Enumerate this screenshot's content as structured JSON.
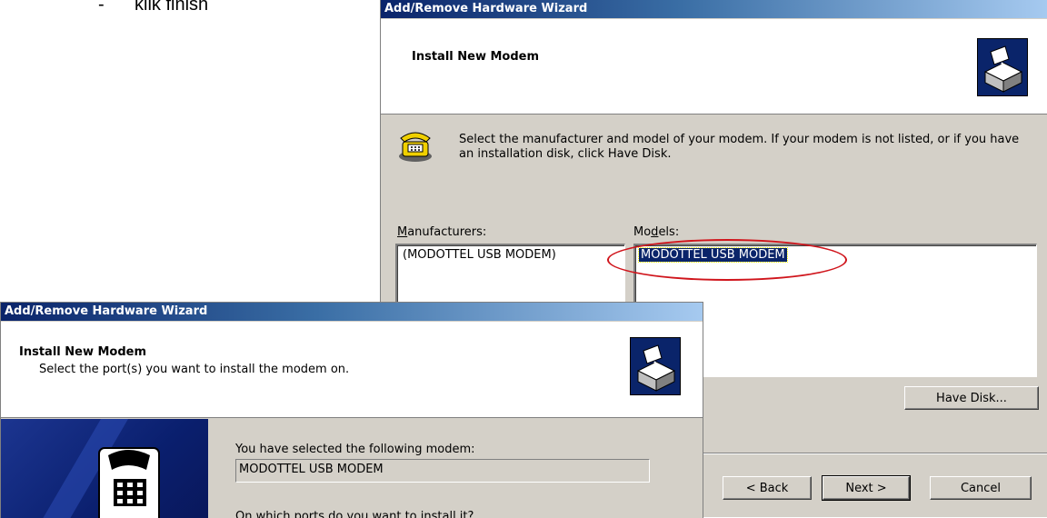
{
  "document": {
    "bullet_dash": "-",
    "bullet_text": "klik finish"
  },
  "back_wizard": {
    "title": "Add/Remove Hardware Wizard",
    "header_title": "Install New Modem",
    "instructions": "Select the manufacturer and model of your modem. If your modem is not listed, or if you have an installation disk, click Have Disk.",
    "manufacturers_label": "Manufacturers:",
    "models_label": "Models:",
    "manufacturers": [
      "(MODOTTEL USB MODEM)"
    ],
    "models": [
      "MODOTTEL USB MODEM"
    ],
    "have_disk_button": "Have Disk...",
    "back_button": "< Back",
    "next_button": "Next >",
    "cancel_button": "Cancel"
  },
  "front_wizard": {
    "title": "Add/Remove Hardware Wizard",
    "header_title": "Install New Modem",
    "header_subtitle": "Select the port(s) you want to install the modem on.",
    "selected_label": "You have selected the following modem:",
    "selected_modem": "MODOTTEL USB MODEM",
    "port_question": "On which ports do you want to install it?"
  },
  "colors": {
    "title_bar": "#0a246a",
    "selection": "#0a246a",
    "annotation_ellipse": "#d0151c",
    "dialog_face": "#d4d0c8"
  },
  "icons": [
    "hardware-wizard-icon",
    "telephone-modem-icon"
  ]
}
